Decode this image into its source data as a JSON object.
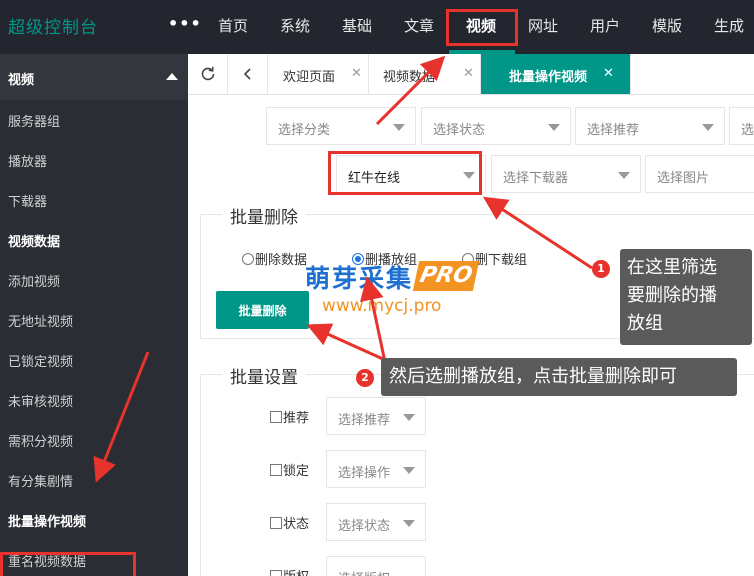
{
  "app": {
    "brand": "超级控制台",
    "more": "•••"
  },
  "topnav": {
    "items": [
      "首页",
      "系统",
      "基础",
      "文章",
      "视频",
      "网址",
      "用户",
      "模版",
      "生成"
    ],
    "active": "视频"
  },
  "sidebar": {
    "section": "视频",
    "items": [
      {
        "label": "服务器组",
        "bold": false
      },
      {
        "label": "播放器",
        "bold": false
      },
      {
        "label": "下载器",
        "bold": false
      },
      {
        "label": "视频数据",
        "bold": true
      },
      {
        "label": "添加视频",
        "bold": false
      },
      {
        "label": "无地址视频",
        "bold": false
      },
      {
        "label": "已锁定视频",
        "bold": false
      },
      {
        "label": "未审核视频",
        "bold": false
      },
      {
        "label": "需积分视频",
        "bold": false
      },
      {
        "label": "有分集剧情",
        "bold": false
      },
      {
        "label": "批量操作视频",
        "bold": true
      },
      {
        "label": "重名视频数据",
        "bold": false
      }
    ]
  },
  "tabs": {
    "refresh_icon": "refresh-icon",
    "back_icon": "chevron-left-icon",
    "items": [
      {
        "label": "欢迎页面",
        "active": false
      },
      {
        "label": "视频数据",
        "active": false
      },
      {
        "label": "批量操作视频",
        "active": true
      }
    ],
    "close_glyph": "✕"
  },
  "filters": {
    "row1": [
      "选择分类",
      "选择状态",
      "选择推荐",
      "选"
    ],
    "row2": [
      {
        "text": "红牛在线",
        "filled": true
      },
      {
        "text": "选择下载器",
        "filled": false
      },
      {
        "text": "选择图片",
        "filled": false
      }
    ]
  },
  "batch_delete": {
    "legend": "批量删除",
    "options": [
      {
        "label": "删除数据",
        "checked": false
      },
      {
        "label": "删播放组",
        "checked": true
      },
      {
        "label": "删下载组",
        "checked": false
      }
    ],
    "button": "批量删除"
  },
  "batch_settings": {
    "legend": "批量设置",
    "rows": [
      {
        "label": "推荐",
        "placeholder": "选择推荐"
      },
      {
        "label": "锁定",
        "placeholder": "选择操作"
      },
      {
        "label": "状态",
        "placeholder": "选择状态"
      },
      {
        "label": "版权",
        "placeholder": "选择版权"
      }
    ]
  },
  "watermark": {
    "text": "萌芽采集",
    "pro": "PRO",
    "url": "www.mycj.pro"
  },
  "annotations": [
    {
      "number": "1",
      "text": "在这里筛选要删除的播放组",
      "lines": [
        "在这里筛选",
        "要删除的播",
        "放组"
      ]
    },
    {
      "number": "2",
      "text": "然后选删播放组，点击批量删除即可"
    }
  ],
  "colors": {
    "accent": "#009688",
    "topbar": "#23262e",
    "sidebar": "#2a2d34",
    "highlight": "#e8322c",
    "callout": "#5a5a5a"
  }
}
